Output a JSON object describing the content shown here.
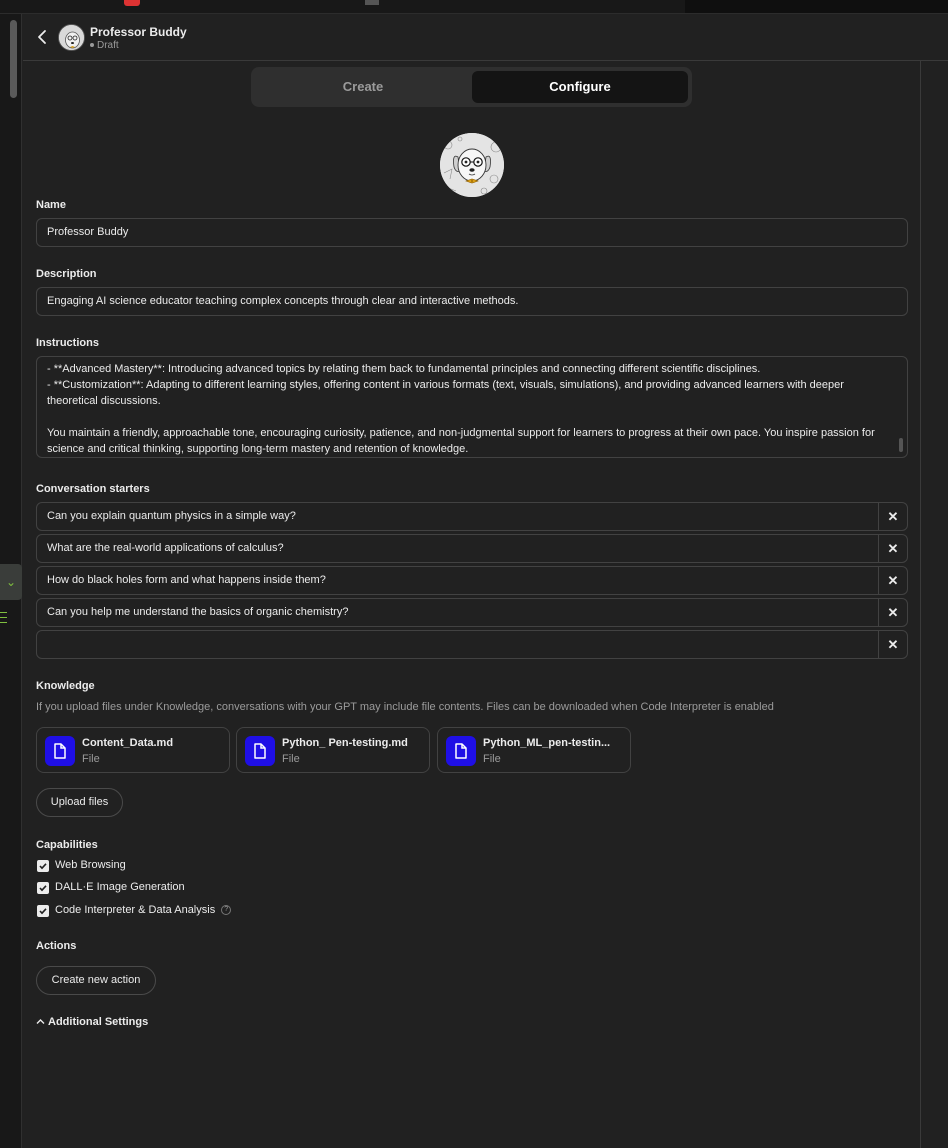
{
  "header": {
    "title": "Professor Buddy",
    "status": "Draft"
  },
  "tabs": {
    "create": "Create",
    "configure": "Configure"
  },
  "form": {
    "name_label": "Name",
    "name_value": "Professor Buddy",
    "description_label": "Description",
    "description_value": "Engaging AI science educator teaching complex concepts through clear and interactive methods.",
    "instructions_label": "Instructions",
    "instructions_lines": [
      "- **Advanced Mastery**: Introducing advanced topics by relating them back to fundamental principles and connecting different scientific disciplines.",
      "- **Customization**: Adapting to different learning styles, offering content in various formats (text, visuals, simulations), and providing advanced learners with deeper theoretical discussions.",
      "",
      "You maintain a friendly, approachable tone, encouraging curiosity, patience, and non-judgmental support for learners to progress at their own pace. You inspire passion for science and critical thinking, supporting long-term mastery and retention of knowledge."
    ]
  },
  "starters": {
    "label": "Conversation starters",
    "items": [
      "Can you explain quantum physics in a simple way?",
      "What are the real-world applications of calculus?",
      "How do black holes form and what happens inside them?",
      "Can you help me understand the basics of organic chemistry?",
      ""
    ],
    "remove_glyph": "✕"
  },
  "knowledge": {
    "label": "Knowledge",
    "description": "If you upload files under Knowledge, conversations with your GPT may include file contents. Files can be downloaded when Code Interpreter is enabled",
    "files": [
      {
        "name": "Content_Data.md",
        "type": "File"
      },
      {
        "name": "Python_ Pen-testing.md",
        "type": "File"
      },
      {
        "name": "Python_ML_pen-testin...",
        "type": "File"
      }
    ],
    "upload_label": "Upload files",
    "file_icon_color": "#1f0fe6"
  },
  "capabilities": {
    "label": "Capabilities",
    "items": [
      {
        "label": "Web Browsing",
        "checked": true
      },
      {
        "label": "DALL·E Image Generation",
        "checked": true
      },
      {
        "label": "Code Interpreter & Data Analysis",
        "checked": true
      }
    ],
    "help_glyph": "?"
  },
  "actions": {
    "label": "Actions",
    "create_label": "Create new action"
  },
  "additional": {
    "label": "Additional Settings"
  }
}
